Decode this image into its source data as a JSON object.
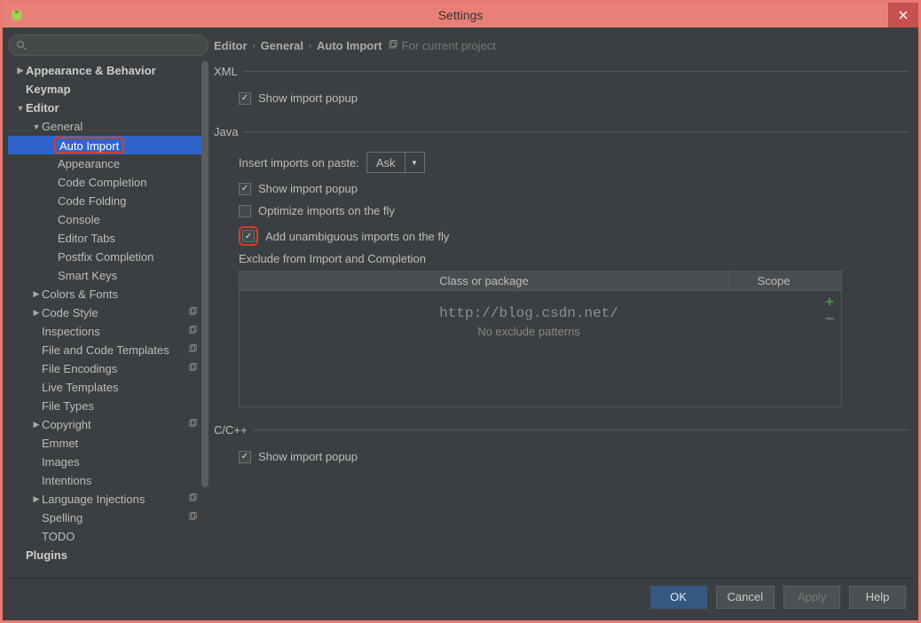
{
  "window": {
    "title": "Settings"
  },
  "search": {
    "placeholder": ""
  },
  "sidebar": {
    "items": [
      {
        "label": "Appearance & Behavior",
        "level": 0,
        "bold": true,
        "arrow": "closed"
      },
      {
        "label": "Keymap",
        "level": 0,
        "bold": true
      },
      {
        "label": "Editor",
        "level": 0,
        "bold": true,
        "arrow": "open"
      },
      {
        "label": "General",
        "level": 1,
        "arrow": "open"
      },
      {
        "label": "Auto Import",
        "level": 2,
        "selected": true,
        "highlight": true
      },
      {
        "label": "Appearance",
        "level": 2
      },
      {
        "label": "Code Completion",
        "level": 2
      },
      {
        "label": "Code Folding",
        "level": 2
      },
      {
        "label": "Console",
        "level": 2
      },
      {
        "label": "Editor Tabs",
        "level": 2
      },
      {
        "label": "Postfix Completion",
        "level": 2
      },
      {
        "label": "Smart Keys",
        "level": 2
      },
      {
        "label": "Colors & Fonts",
        "level": 1,
        "arrow": "closed"
      },
      {
        "label": "Code Style",
        "level": 1,
        "arrow": "closed",
        "copy": true
      },
      {
        "label": "Inspections",
        "level": 1,
        "copy": true
      },
      {
        "label": "File and Code Templates",
        "level": 1,
        "copy": true
      },
      {
        "label": "File Encodings",
        "level": 1,
        "copy": true
      },
      {
        "label": "Live Templates",
        "level": 1
      },
      {
        "label": "File Types",
        "level": 1
      },
      {
        "label": "Copyright",
        "level": 1,
        "arrow": "closed",
        "copy": true
      },
      {
        "label": "Emmet",
        "level": 1
      },
      {
        "label": "Images",
        "level": 1
      },
      {
        "label": "Intentions",
        "level": 1
      },
      {
        "label": "Language Injections",
        "level": 1,
        "arrow": "closed",
        "copy": true
      },
      {
        "label": "Spelling",
        "level": 1,
        "copy": true
      },
      {
        "label": "TODO",
        "level": 1
      },
      {
        "label": "Plugins",
        "level": 0,
        "bold": true
      }
    ]
  },
  "breadcrumb": {
    "parts": [
      "Editor",
      "General",
      "Auto Import"
    ],
    "hint": "For current project"
  },
  "xml": {
    "legend": "XML",
    "show_import_popup_label": "Show import popup",
    "show_import_popup_checked": true
  },
  "java": {
    "legend": "Java",
    "insert_label": "Insert imports on paste:",
    "insert_value": "Ask",
    "show_import_popup_label": "Show import popup",
    "show_import_popup_checked": true,
    "optimize_label": "Optimize imports on the fly",
    "optimize_checked": false,
    "unambiguous_label": "Add unambiguous imports on the fly",
    "unambiguous_checked": true,
    "exclude_legend": "Exclude from Import and Completion",
    "col_class": "Class or package",
    "col_scope": "Scope",
    "empty_text": "No exclude patterns",
    "watermark": "http://blog.csdn.net/"
  },
  "cpp": {
    "legend": "C/C++",
    "show_import_popup_label": "Show import popup",
    "show_import_popup_checked": true
  },
  "buttons": {
    "ok": "OK",
    "cancel": "Cancel",
    "apply": "Apply",
    "help": "Help"
  }
}
